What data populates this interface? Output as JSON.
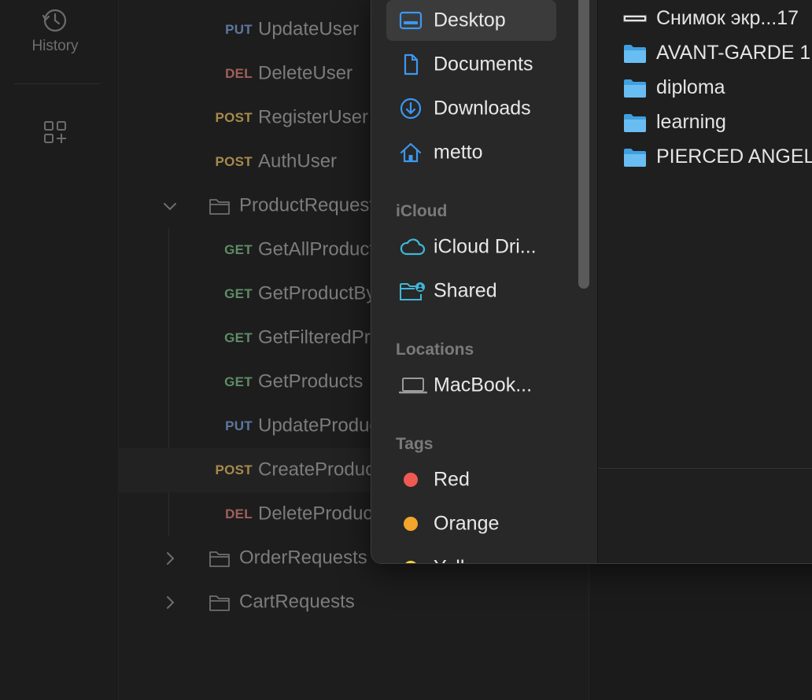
{
  "rail": {
    "history_label": "History"
  },
  "requests": [
    {
      "method": "PUT",
      "name": "UpdateUser"
    },
    {
      "method": "DEL",
      "name": "DeleteUser"
    },
    {
      "method": "POST",
      "name": "RegisterUser"
    },
    {
      "method": "POST",
      "name": "AuthUser"
    },
    {
      "folder": "ProductRequests"
    },
    {
      "method": "GET",
      "name": "GetAllProducts"
    },
    {
      "method": "GET",
      "name": "GetProductById"
    },
    {
      "method": "GET",
      "name": "GetFilteredProducts"
    },
    {
      "method": "GET",
      "name": "GetProducts"
    },
    {
      "method": "PUT",
      "name": "UpdateProduct"
    },
    {
      "method": "POST",
      "name": "CreateProduct"
    },
    {
      "method": "DEL",
      "name": "DeleteProduct"
    },
    {
      "folder": "OrderRequests"
    },
    {
      "folder": "CartRequests"
    }
  ],
  "picker": {
    "favorites": [
      {
        "label": "Desktop",
        "icon": "desktop-icon"
      },
      {
        "label": "Documents",
        "icon": "document-icon"
      },
      {
        "label": "Downloads",
        "icon": "download-icon"
      },
      {
        "label": "metto",
        "icon": "home-icon"
      }
    ],
    "icloud_header": "iCloud",
    "icloud": [
      {
        "label": "iCloud Dri...",
        "icon": "cloud-icon"
      },
      {
        "label": "Shared",
        "icon": "shared-folder-icon"
      }
    ],
    "locations_header": "Locations",
    "locations": [
      {
        "label": "MacBook...",
        "icon": "laptop-icon"
      }
    ],
    "tags_header": "Tags",
    "tags": [
      {
        "label": "Red",
        "color": "#ee5a52"
      },
      {
        "label": "Orange",
        "color": "#f3a52b"
      },
      {
        "label": "Yellow",
        "color": "#f3d23a"
      }
    ],
    "files": [
      {
        "name": "Снимок экр...17",
        "icon": "screenshot-file-icon"
      },
      {
        "name": "AVANT-GARDE 1",
        "icon": "folder-icon"
      },
      {
        "name": "diploma",
        "icon": "folder-icon"
      },
      {
        "name": "learning",
        "icon": "folder-icon"
      },
      {
        "name": "PIERCED ANGEL",
        "icon": "folder-icon"
      }
    ]
  }
}
